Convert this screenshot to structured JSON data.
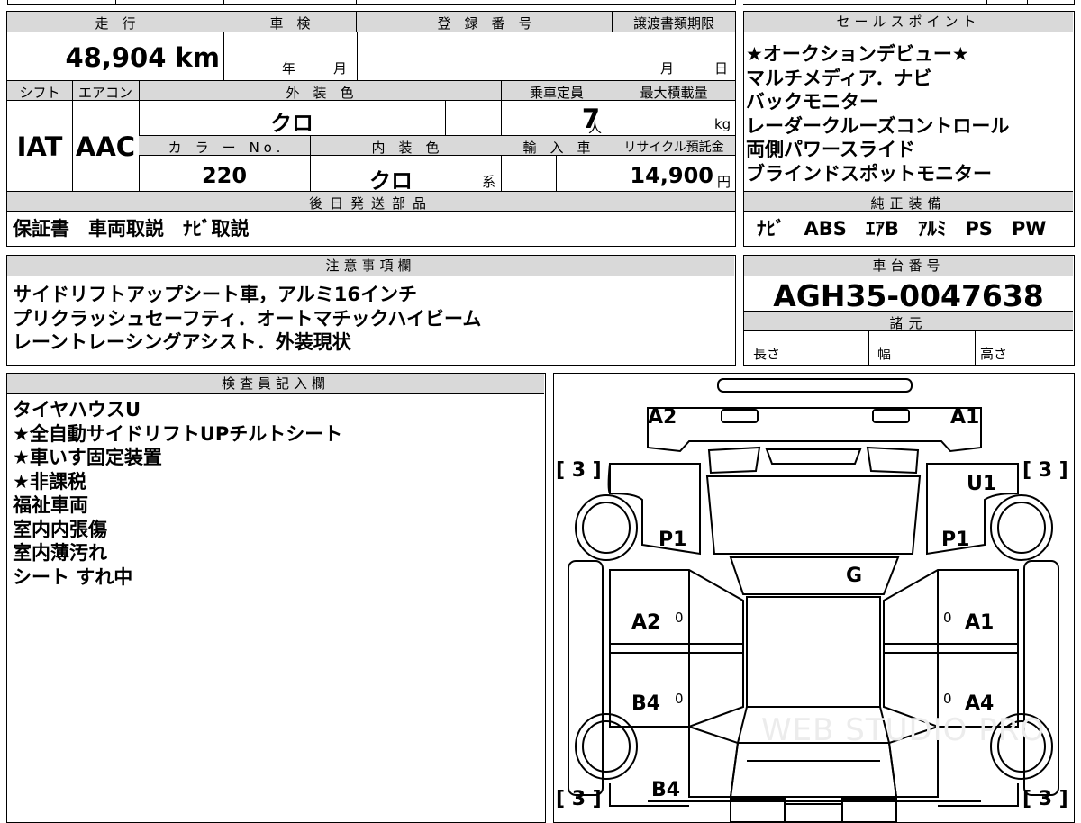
{
  "vehicle": {
    "mileage_label": "走　行",
    "mileage_value": "48,904 km",
    "inspection_label": "車　検",
    "inspection_year": "年",
    "inspection_month": "月",
    "registration_label": "登　録　番　号",
    "transfer_label": "譲渡書類期限",
    "transfer_month": "月",
    "transfer_day": "日",
    "shift_label": "シフト",
    "shift_value": "IAT",
    "ac_label": "エアコン",
    "ac_value": "AAC",
    "exterior_color_label": "外　装　色",
    "exterior_color_value": "クロ",
    "capacity_label": "乗車定員",
    "capacity_value": "7",
    "capacity_unit": "人",
    "max_load_label": "最大積載量",
    "max_load_unit": "kg",
    "color_no_label": "カ　ラ　ー　N o .",
    "color_no_value": "220",
    "interior_color_label": "内　装　色",
    "interior_color_value": "クロ",
    "interior_color_suffix": "系",
    "import_label": "輸　入　車",
    "recycle_label": "リサイクル預託金",
    "recycle_value": "14,900",
    "recycle_unit": "円"
  },
  "sales_points": {
    "title": "セールスポイント",
    "items": [
      "★オークションデビュー★",
      "マルチメディア．ナビ",
      "バックモニター",
      "レーダークルーズコントロール",
      "両側パワースライド",
      "ブラインドスポットモニター"
    ]
  },
  "later_parts": {
    "title": "後日発送部品",
    "value": "保証書　車両取説　ﾅﾋﾞ取説"
  },
  "genuine_equipment": {
    "title": "純正装備",
    "value": "ﾅﾋﾞ　ABS　ｴｱB　ｱﾙﾐ　PS　PW"
  },
  "notes": {
    "title": "注意事項欄",
    "lines": [
      "サイドリフトアップシート車，アルミ16インチ",
      "プリクラッシュセーフティ．オートマチックハイビーム",
      "レーントレーシングアシスト．外装現状"
    ]
  },
  "chassis": {
    "title": "車台番号",
    "value": "AGH35-0047638",
    "specs_title": "諸元",
    "length_label": "長さ",
    "width_label": "幅",
    "height_label": "高さ"
  },
  "inspector": {
    "title": "検査員記入欄",
    "lines": [
      "タイヤハウスU",
      "★全自動サイドリフトUPチルトシート",
      "★車いす固定装置",
      "★非課税",
      "福祉車両",
      "室内内張傷",
      "室内薄汚れ",
      "シート すれ中"
    ]
  },
  "diagram": {
    "marks": {
      "front_left": "A2",
      "front_right": "A1",
      "right_fender": "U1",
      "left_fender_p": "P1",
      "right_fender_p": "P1",
      "windshield": "G",
      "left_front_door": "A2",
      "right_front_door": "A1",
      "left_rear_door": "B4",
      "right_rear_door": "A4",
      "rear_left": "B4",
      "tire_fl": "[ 3 ]",
      "tire_fr": "[ 3 ]",
      "tire_rl": "[ 3 ]",
      "tire_rr": "[ 3 ]",
      "zero": "0"
    },
    "watermark": "WEB STUDIO PRO"
  }
}
